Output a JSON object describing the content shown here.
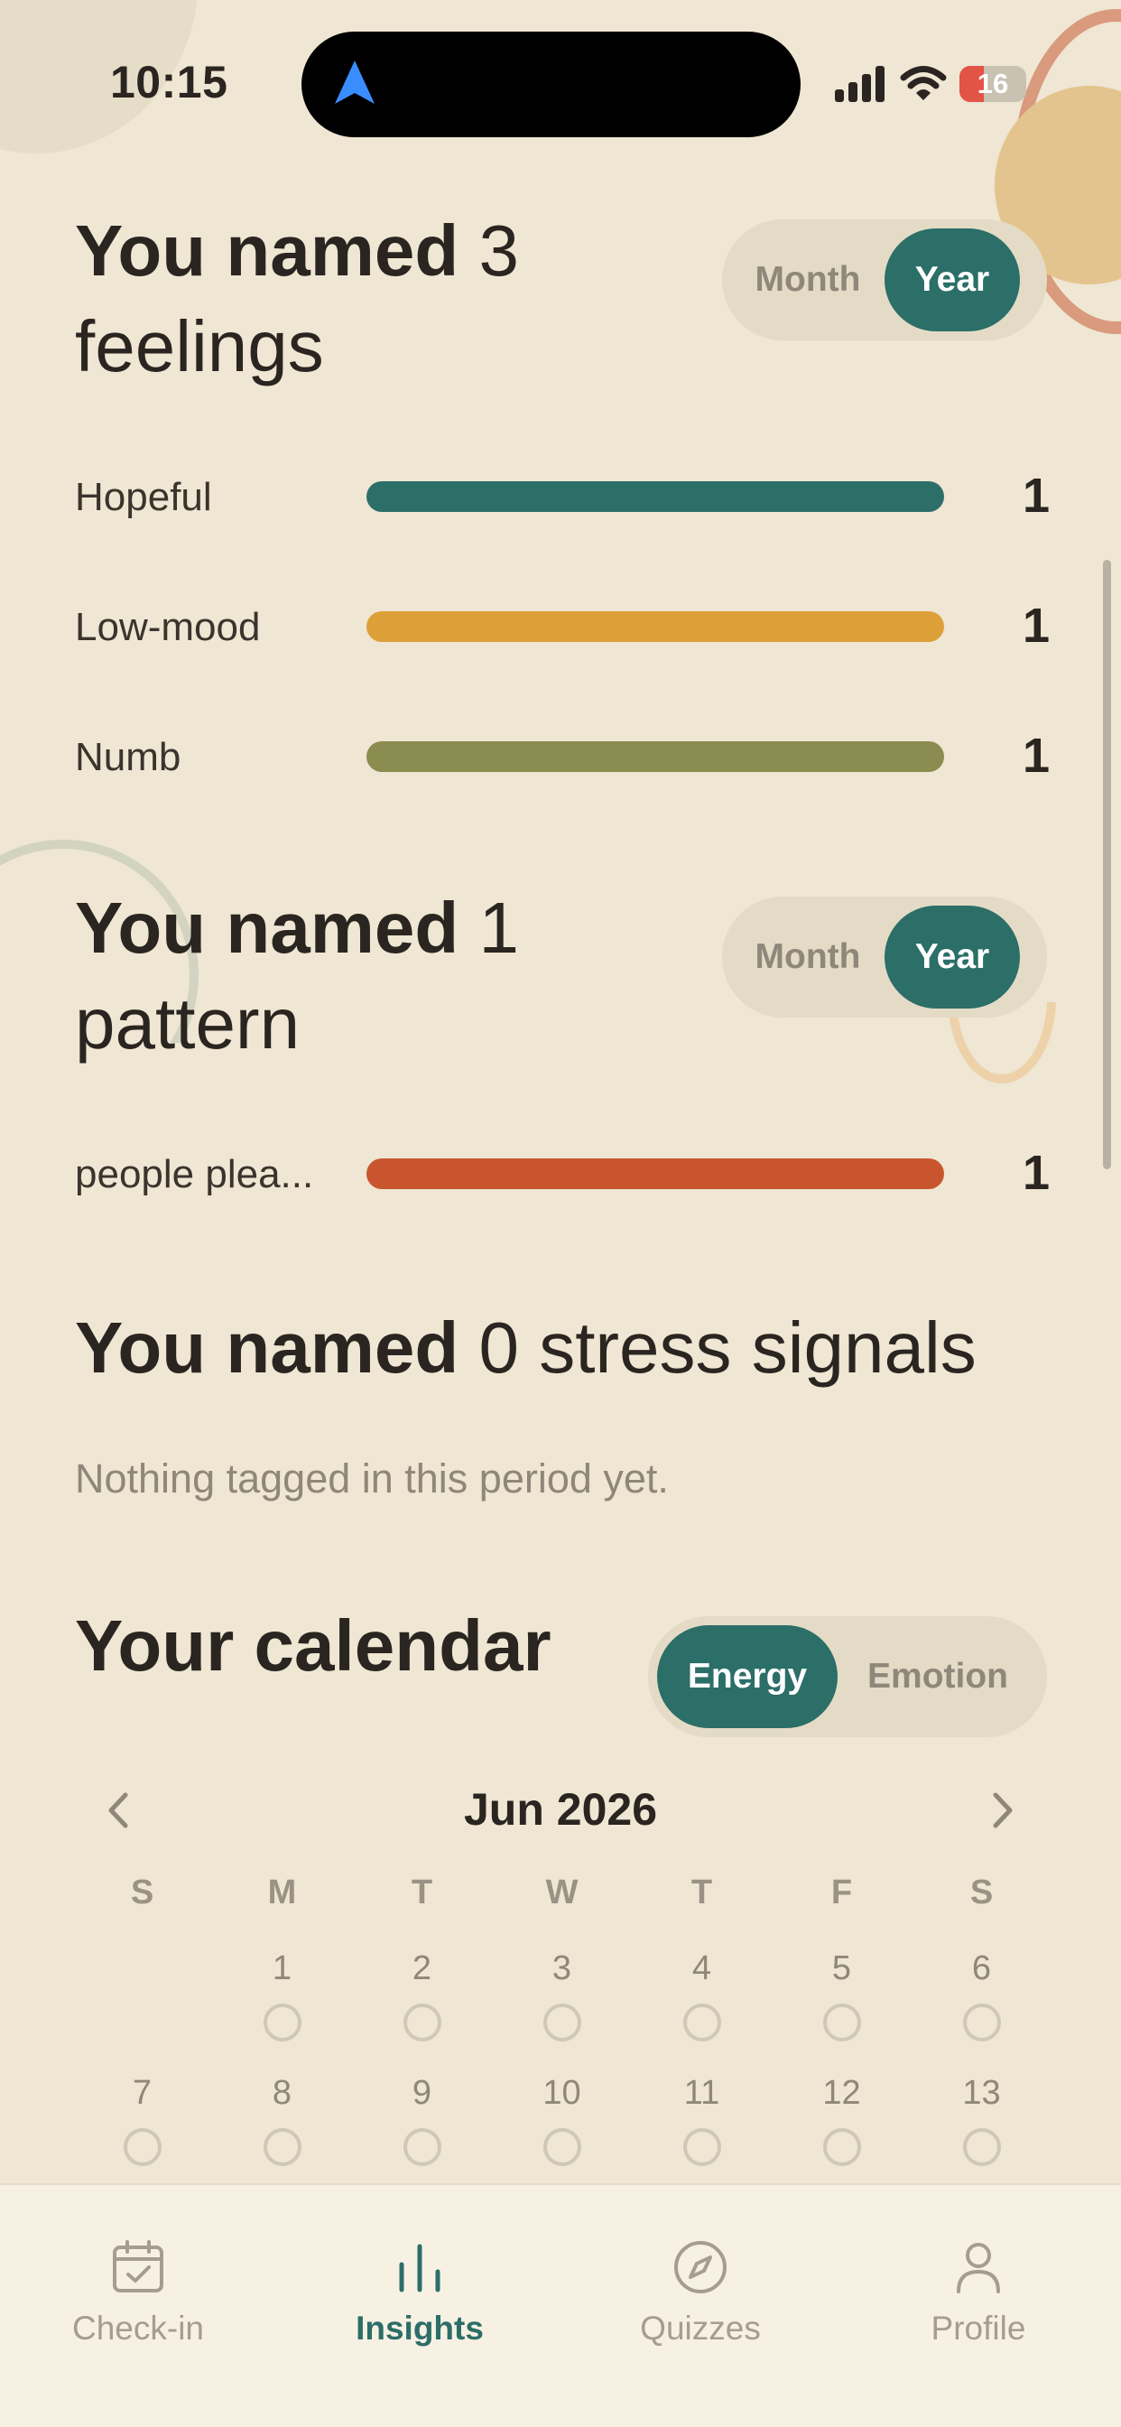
{
  "status_bar": {
    "time": "10:15",
    "battery_level": "16",
    "battery_color": "#E25446"
  },
  "feelings": {
    "title_prefix": "You named",
    "title_count": "3",
    "title_noun": "feelings",
    "toggle": {
      "month": "Month",
      "year": "Year",
      "selected": "Year"
    },
    "items": [
      {
        "label": "Hopeful",
        "count": "1",
        "color": "#2C6E68",
        "fill": 1.0
      },
      {
        "label": "Low-mood",
        "count": "1",
        "color": "#DDA038",
        "fill": 1.0
      },
      {
        "label": "Numb",
        "count": "1",
        "color": "#8B8C4F",
        "fill": 1.0
      }
    ]
  },
  "patterns": {
    "title_prefix": "You named",
    "title_count": "1",
    "title_noun": "pattern",
    "toggle": {
      "month": "Month",
      "year": "Year",
      "selected": "Year"
    },
    "items": [
      {
        "label": "people plea...",
        "count": "1",
        "color": "#C9552F",
        "fill": 1.0
      }
    ]
  },
  "stress": {
    "title_prefix": "You named",
    "title_rest": "0 stress signals",
    "empty_text": "Nothing tagged in this period yet."
  },
  "calendar": {
    "title": "Your calendar",
    "toggle": {
      "energy": "Energy",
      "emotion": "Emotion",
      "selected": "Energy"
    },
    "month_label": "Jun 2026",
    "weekdays": [
      "S",
      "M",
      "T",
      "W",
      "T",
      "F",
      "S"
    ],
    "weeks": [
      [
        "",
        "1",
        "2",
        "3",
        "4",
        "5",
        "6"
      ],
      [
        "7",
        "8",
        "9",
        "10",
        "11",
        "12",
        "13"
      ]
    ]
  },
  "tabbar": {
    "items": [
      {
        "label": "Check-in",
        "icon": "calendar-check-icon",
        "active": false
      },
      {
        "label": "Insights",
        "icon": "bar-chart-icon",
        "active": true
      },
      {
        "label": "Quizzes",
        "icon": "compass-icon",
        "active": false
      },
      {
        "label": "Profile",
        "icon": "person-icon",
        "active": false
      }
    ]
  },
  "colors": {
    "accent": "#2C6E68",
    "background": "#EFE6D3"
  }
}
